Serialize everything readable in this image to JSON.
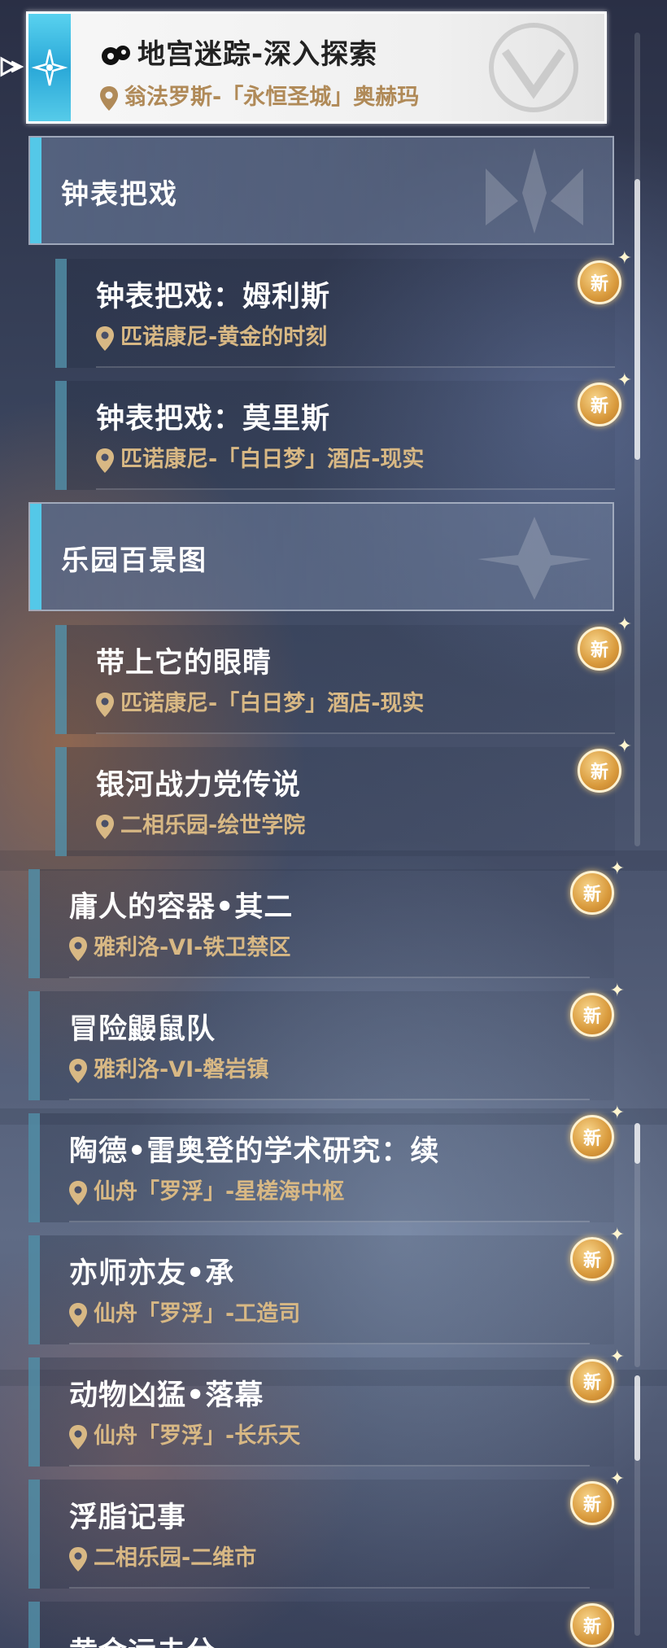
{
  "selected": {
    "title": "地宫迷踪-深入探索",
    "location": "翁法罗斯-「永恒圣城」奥赫玛"
  },
  "categories": [
    {
      "label": "钟表把戏",
      "items": [
        {
          "title": "钟表把戏：姆利斯",
          "location": "匹诺康尼-黄金的时刻",
          "badge": "新"
        },
        {
          "title": "钟表把戏：莫里斯",
          "location": "匹诺康尼-「白日梦」酒店-现实",
          "badge": "新"
        }
      ]
    },
    {
      "label": "乐园百景图",
      "items": [
        {
          "title": "带上它的眼睛",
          "location": "匹诺康尼-「白日梦」酒店-现实",
          "badge": "新"
        },
        {
          "title": "银河战力党传说",
          "location": "二相乐园-绘世学院",
          "badge": "新"
        }
      ]
    }
  ],
  "list": [
    {
      "title": "庸人的容器•其二",
      "location": "雅利洛-VI-铁卫禁区",
      "badge": "新"
    },
    {
      "title": "冒险鼹鼠队",
      "location": "雅利洛-VI-磐岩镇",
      "badge": "新"
    },
    {
      "title": "陶德•雷奥登的学术研究：续",
      "location": "仙舟「罗浮」-星槎海中枢",
      "badge": "新"
    },
    {
      "title": "亦师亦友•承",
      "location": "仙舟「罗浮」-工造司",
      "badge": "新"
    },
    {
      "title": "动物凶猛•落幕",
      "location": "仙舟「罗浮」-长乐天",
      "badge": "新"
    },
    {
      "title": "浮脂记事",
      "location": "二相乐园-二维市",
      "badge": "新"
    },
    {
      "title": "黄金远去兮",
      "location": "",
      "badge": "新"
    }
  ],
  "colors": {
    "accent_cyan": "#54c8e8",
    "location_gold": "#d8b884",
    "badge_gold": "#d99a3c"
  }
}
